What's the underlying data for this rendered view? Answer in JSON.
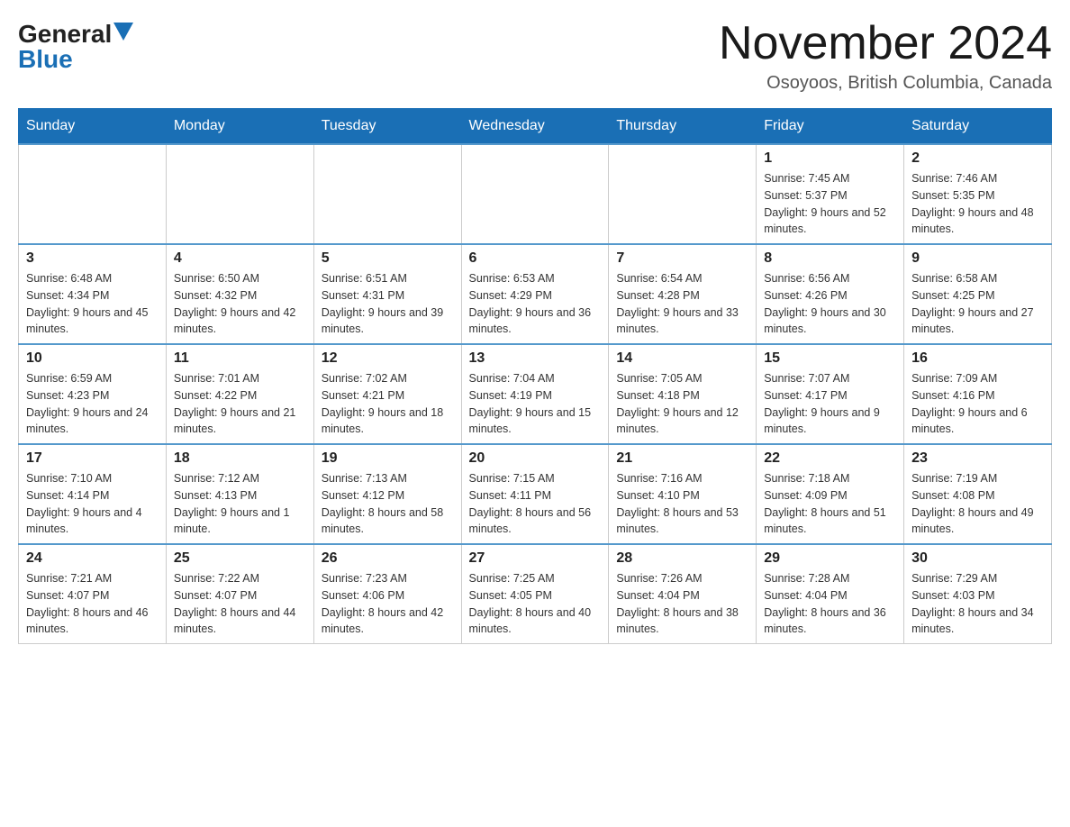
{
  "header": {
    "logo_general": "General",
    "logo_blue": "Blue",
    "month_title": "November 2024",
    "location": "Osoyoos, British Columbia, Canada"
  },
  "calendar": {
    "days_of_week": [
      "Sunday",
      "Monday",
      "Tuesday",
      "Wednesday",
      "Thursday",
      "Friday",
      "Saturday"
    ],
    "weeks": [
      [
        {
          "day": "",
          "info": ""
        },
        {
          "day": "",
          "info": ""
        },
        {
          "day": "",
          "info": ""
        },
        {
          "day": "",
          "info": ""
        },
        {
          "day": "",
          "info": ""
        },
        {
          "day": "1",
          "info": "Sunrise: 7:45 AM\nSunset: 5:37 PM\nDaylight: 9 hours and 52 minutes."
        },
        {
          "day": "2",
          "info": "Sunrise: 7:46 AM\nSunset: 5:35 PM\nDaylight: 9 hours and 48 minutes."
        }
      ],
      [
        {
          "day": "3",
          "info": "Sunrise: 6:48 AM\nSunset: 4:34 PM\nDaylight: 9 hours and 45 minutes."
        },
        {
          "day": "4",
          "info": "Sunrise: 6:50 AM\nSunset: 4:32 PM\nDaylight: 9 hours and 42 minutes."
        },
        {
          "day": "5",
          "info": "Sunrise: 6:51 AM\nSunset: 4:31 PM\nDaylight: 9 hours and 39 minutes."
        },
        {
          "day": "6",
          "info": "Sunrise: 6:53 AM\nSunset: 4:29 PM\nDaylight: 9 hours and 36 minutes."
        },
        {
          "day": "7",
          "info": "Sunrise: 6:54 AM\nSunset: 4:28 PM\nDaylight: 9 hours and 33 minutes."
        },
        {
          "day": "8",
          "info": "Sunrise: 6:56 AM\nSunset: 4:26 PM\nDaylight: 9 hours and 30 minutes."
        },
        {
          "day": "9",
          "info": "Sunrise: 6:58 AM\nSunset: 4:25 PM\nDaylight: 9 hours and 27 minutes."
        }
      ],
      [
        {
          "day": "10",
          "info": "Sunrise: 6:59 AM\nSunset: 4:23 PM\nDaylight: 9 hours and 24 minutes."
        },
        {
          "day": "11",
          "info": "Sunrise: 7:01 AM\nSunset: 4:22 PM\nDaylight: 9 hours and 21 minutes."
        },
        {
          "day": "12",
          "info": "Sunrise: 7:02 AM\nSunset: 4:21 PM\nDaylight: 9 hours and 18 minutes."
        },
        {
          "day": "13",
          "info": "Sunrise: 7:04 AM\nSunset: 4:19 PM\nDaylight: 9 hours and 15 minutes."
        },
        {
          "day": "14",
          "info": "Sunrise: 7:05 AM\nSunset: 4:18 PM\nDaylight: 9 hours and 12 minutes."
        },
        {
          "day": "15",
          "info": "Sunrise: 7:07 AM\nSunset: 4:17 PM\nDaylight: 9 hours and 9 minutes."
        },
        {
          "day": "16",
          "info": "Sunrise: 7:09 AM\nSunset: 4:16 PM\nDaylight: 9 hours and 6 minutes."
        }
      ],
      [
        {
          "day": "17",
          "info": "Sunrise: 7:10 AM\nSunset: 4:14 PM\nDaylight: 9 hours and 4 minutes."
        },
        {
          "day": "18",
          "info": "Sunrise: 7:12 AM\nSunset: 4:13 PM\nDaylight: 9 hours and 1 minute."
        },
        {
          "day": "19",
          "info": "Sunrise: 7:13 AM\nSunset: 4:12 PM\nDaylight: 8 hours and 58 minutes."
        },
        {
          "day": "20",
          "info": "Sunrise: 7:15 AM\nSunset: 4:11 PM\nDaylight: 8 hours and 56 minutes."
        },
        {
          "day": "21",
          "info": "Sunrise: 7:16 AM\nSunset: 4:10 PM\nDaylight: 8 hours and 53 minutes."
        },
        {
          "day": "22",
          "info": "Sunrise: 7:18 AM\nSunset: 4:09 PM\nDaylight: 8 hours and 51 minutes."
        },
        {
          "day": "23",
          "info": "Sunrise: 7:19 AM\nSunset: 4:08 PM\nDaylight: 8 hours and 49 minutes."
        }
      ],
      [
        {
          "day": "24",
          "info": "Sunrise: 7:21 AM\nSunset: 4:07 PM\nDaylight: 8 hours and 46 minutes."
        },
        {
          "day": "25",
          "info": "Sunrise: 7:22 AM\nSunset: 4:07 PM\nDaylight: 8 hours and 44 minutes."
        },
        {
          "day": "26",
          "info": "Sunrise: 7:23 AM\nSunset: 4:06 PM\nDaylight: 8 hours and 42 minutes."
        },
        {
          "day": "27",
          "info": "Sunrise: 7:25 AM\nSunset: 4:05 PM\nDaylight: 8 hours and 40 minutes."
        },
        {
          "day": "28",
          "info": "Sunrise: 7:26 AM\nSunset: 4:04 PM\nDaylight: 8 hours and 38 minutes."
        },
        {
          "day": "29",
          "info": "Sunrise: 7:28 AM\nSunset: 4:04 PM\nDaylight: 8 hours and 36 minutes."
        },
        {
          "day": "30",
          "info": "Sunrise: 7:29 AM\nSunset: 4:03 PM\nDaylight: 8 hours and 34 minutes."
        }
      ]
    ]
  }
}
